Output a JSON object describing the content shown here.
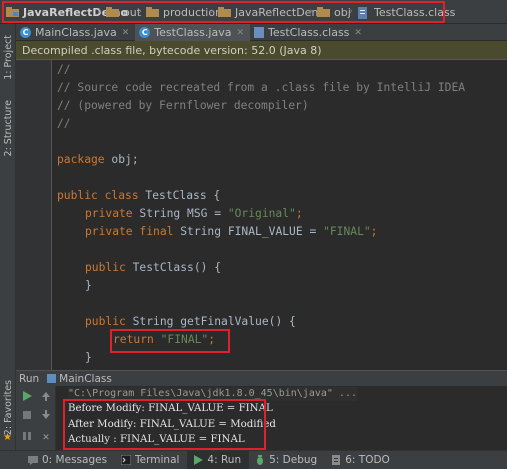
{
  "breadcrumb": {
    "items": [
      {
        "label": "JavaReflectDemo",
        "icon": "project-folder-icon"
      },
      {
        "label": "out",
        "icon": "folder-icon"
      },
      {
        "label": "production",
        "icon": "folder-icon"
      },
      {
        "label": "JavaReflectDemo",
        "icon": "folder-icon"
      },
      {
        "label": "obj",
        "icon": "folder-icon"
      },
      {
        "label": "TestClass.class",
        "icon": "class-file-icon"
      }
    ]
  },
  "left_tools": {
    "project": "1: Project",
    "structure": "2: Structure",
    "favorites": "2: Favorites"
  },
  "tabs": [
    {
      "label": "MainClass.java",
      "icon": "java-class-icon",
      "active": false
    },
    {
      "label": "TestClass.java",
      "icon": "java-class-icon",
      "active": true
    },
    {
      "label": "TestClass.class",
      "icon": "class-file-icon",
      "active": false
    }
  ],
  "banner": {
    "text": "Decompiled .class file, bytecode version: 52.0 (Java 8)"
  },
  "code": {
    "c1": "//",
    "c2": "// Source code recreated from a .class file by IntelliJ IDEA",
    "c3": "// (powered by Fernflower decompiler)",
    "c4": "//",
    "pkg_kw": "package",
    "pkg_name": " obj;",
    "cls_kw": "public class",
    "cls_name": " TestClass {",
    "f1_kw": "private",
    "f1_type": " String MSG = ",
    "f1_val": "\"Original\"",
    "f1_end": ";",
    "f2_kw": "private final",
    "f2_type": " String FINAL_VALUE = ",
    "f2_val": "\"FINAL\"",
    "f2_end": ";",
    "ctor_kw": "public",
    "ctor_name": " TestClass() {",
    "brace": "}",
    "m_kw": "public",
    "m_name": " String getFinalValue() {",
    "ret_kw": "return",
    "ret_val": " \"FINAL\"",
    "ret_end": ";",
    "brace2": "}"
  },
  "run_panel": {
    "label": "Run",
    "tab": "MainClass",
    "command": "\"C:\\Program Files\\Java\\jdk1.8.0_45\\bin\\java\" ...",
    "output": [
      "Before Modify: FINAL_VALUE = FINAL",
      "After Modify: FINAL_VALUE = Modified",
      "Actually : FINAL_VALUE = FINAL"
    ]
  },
  "bottom_tools": [
    {
      "label": "0: Messages",
      "icon": "messages-icon"
    },
    {
      "label": "Terminal",
      "icon": "terminal-icon"
    },
    {
      "label": "4: Run",
      "icon": "run-icon",
      "active": true
    },
    {
      "label": "5: Debug",
      "icon": "debug-icon"
    },
    {
      "label": "6: TODO",
      "icon": "todo-icon"
    }
  ],
  "colors": {
    "highlight": "#e0212b",
    "keyword": "#cc7832",
    "string": "#6a8759",
    "comment": "#808080"
  }
}
